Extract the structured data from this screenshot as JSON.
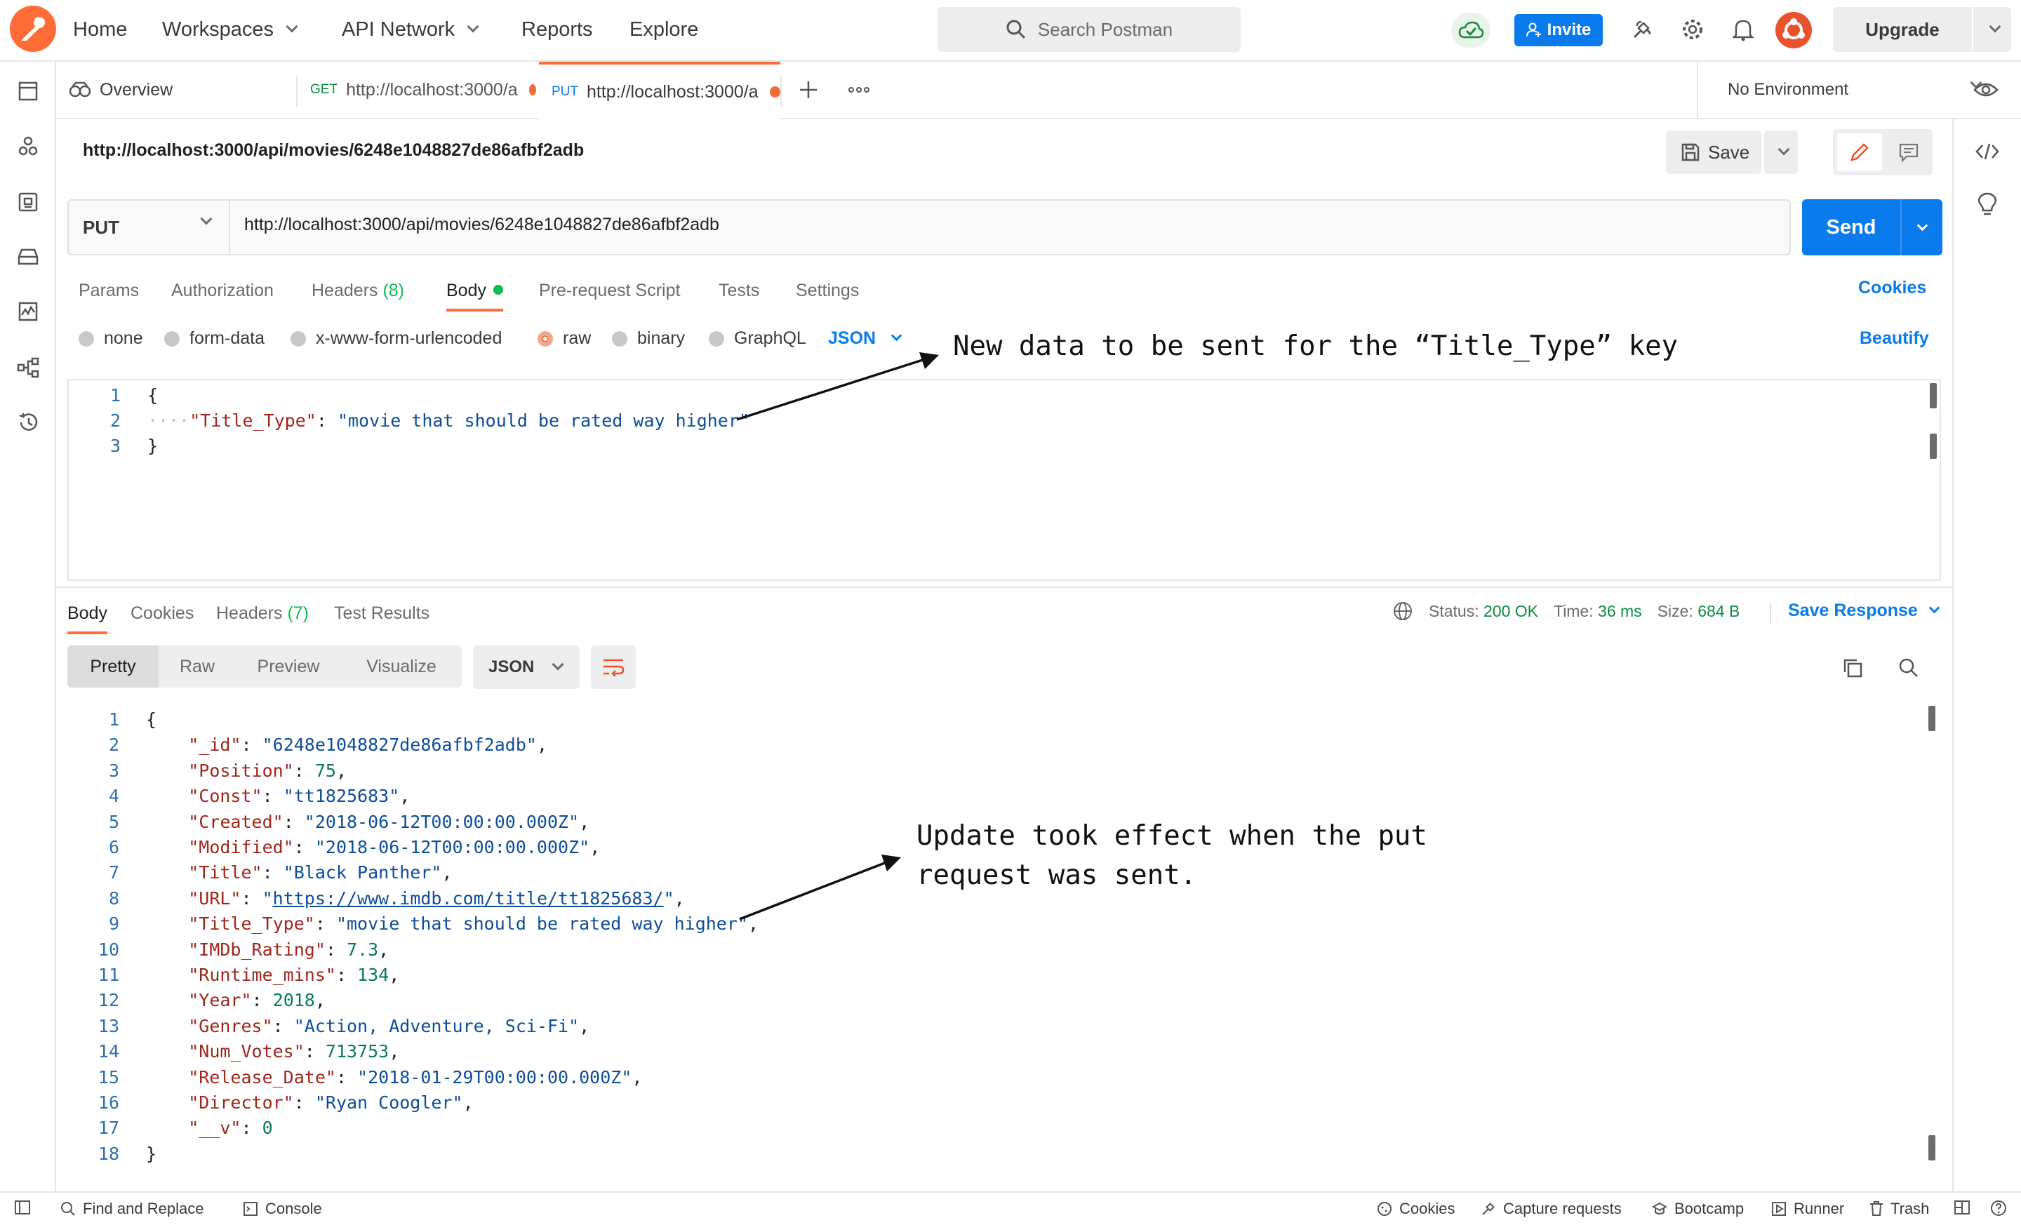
{
  "header": {
    "home": "Home",
    "workspaces": "Workspaces",
    "api_network": "API Network",
    "reports": "Reports",
    "explore": "Explore",
    "search_placeholder": "Search Postman",
    "invite": "Invite",
    "upgrade": "Upgrade"
  },
  "tabs": {
    "overview": "Overview",
    "tab1_method": "GET",
    "tab1_url": "http://localhost:3000/a",
    "tab2_method": "PUT",
    "tab2_url": "http://localhost:3000/a",
    "environment": "No Environment"
  },
  "request": {
    "name": "http://localhost:3000/api/movies/6248e1048827de86afbf2adb",
    "save": "Save",
    "method": "PUT",
    "url": "http://localhost:3000/api/movies/6248e1048827de86afbf2adb",
    "send": "Send",
    "subtabs": {
      "params": "Params",
      "authorization": "Authorization",
      "headers": "Headers",
      "headers_count": "(8)",
      "body": "Body",
      "prerequest": "Pre-request Script",
      "tests": "Tests",
      "settings": "Settings",
      "cookies": "Cookies"
    },
    "body_types": {
      "none": "none",
      "form_data": "form-data",
      "urlencoded": "x-www-form-urlencoded",
      "raw": "raw",
      "binary": "binary",
      "graphql": "GraphQL",
      "format": "JSON",
      "beautify": "Beautify"
    },
    "body_lines": [
      {
        "n": "1",
        "open": "{"
      },
      {
        "n": "2",
        "key": "\"Title_Type\"",
        "val": "\"movie that should be rated way higher\""
      },
      {
        "n": "3",
        "close": "}"
      }
    ]
  },
  "response": {
    "tabs": {
      "body": "Body",
      "cookies": "Cookies",
      "headers": "Headers",
      "headers_count": "(7)",
      "test_results": "Test Results"
    },
    "status_label": "Status:",
    "status_value": "200 OK",
    "time_label": "Time:",
    "time_value": "36 ms",
    "size_label": "Size:",
    "size_value": "684 B",
    "save_response": "Save Response",
    "views": {
      "pretty": "Pretty",
      "raw": "Raw",
      "preview": "Preview",
      "visualize": "Visualize"
    },
    "format": "JSON",
    "lines": [
      {
        "n": "1",
        "open": "{"
      },
      {
        "n": "2",
        "key": "\"_id\"",
        "str": "\"6248e1048827de86afbf2adb\"",
        "comma": ","
      },
      {
        "n": "3",
        "key": "\"Position\"",
        "num": "75",
        "comma": ","
      },
      {
        "n": "4",
        "key": "\"Const\"",
        "str": "\"tt1825683\"",
        "comma": ","
      },
      {
        "n": "5",
        "key": "\"Created\"",
        "str": "\"2018-06-12T00:00:00.000Z\"",
        "comma": ","
      },
      {
        "n": "6",
        "key": "\"Modified\"",
        "str": "\"2018-06-12T00:00:00.000Z\"",
        "comma": ","
      },
      {
        "n": "7",
        "key": "\"Title\"",
        "str": "\"Black Panther\"",
        "comma": ","
      },
      {
        "n": "8",
        "key": "\"URL\"",
        "url": "https://www.imdb.com/title/tt1825683/",
        "comma": ","
      },
      {
        "n": "9",
        "key": "\"Title_Type\"",
        "str": "\"movie that should be rated way higher\"",
        "comma": ","
      },
      {
        "n": "10",
        "key": "\"IMDb_Rating\"",
        "num": "7.3",
        "comma": ","
      },
      {
        "n": "11",
        "key": "\"Runtime_mins\"",
        "num": "134",
        "comma": ","
      },
      {
        "n": "12",
        "key": "\"Year\"",
        "num": "2018",
        "comma": ","
      },
      {
        "n": "13",
        "key": "\"Genres\"",
        "str": "\"Action, Adventure, Sci-Fi\"",
        "comma": ","
      },
      {
        "n": "14",
        "key": "\"Num_Votes\"",
        "num": "713753",
        "comma": ","
      },
      {
        "n": "15",
        "key": "\"Release_Date\"",
        "str": "\"2018-01-29T00:00:00.000Z\"",
        "comma": ","
      },
      {
        "n": "16",
        "key": "\"Director\"",
        "str": "\"Ryan Coogler\"",
        "comma": ","
      },
      {
        "n": "17",
        "key": "\"__v\"",
        "num": "0",
        "comma": ""
      },
      {
        "n": "18",
        "close": "}"
      }
    ]
  },
  "annotations": {
    "request_note": "New data to be sent for the “Title_Type” key",
    "response_note_line1": "Update took effect when the put",
    "response_note_line2": "request was sent."
  },
  "footer": {
    "find_replace": "Find and Replace",
    "console": "Console",
    "cookies": "Cookies",
    "capture": "Capture requests",
    "bootcamp": "Bootcamp",
    "runner": "Runner",
    "trash": "Trash"
  },
  "colors": {
    "brand": "#ff6c37",
    "primary": "#097bed",
    "success": "#0cbb52"
  }
}
